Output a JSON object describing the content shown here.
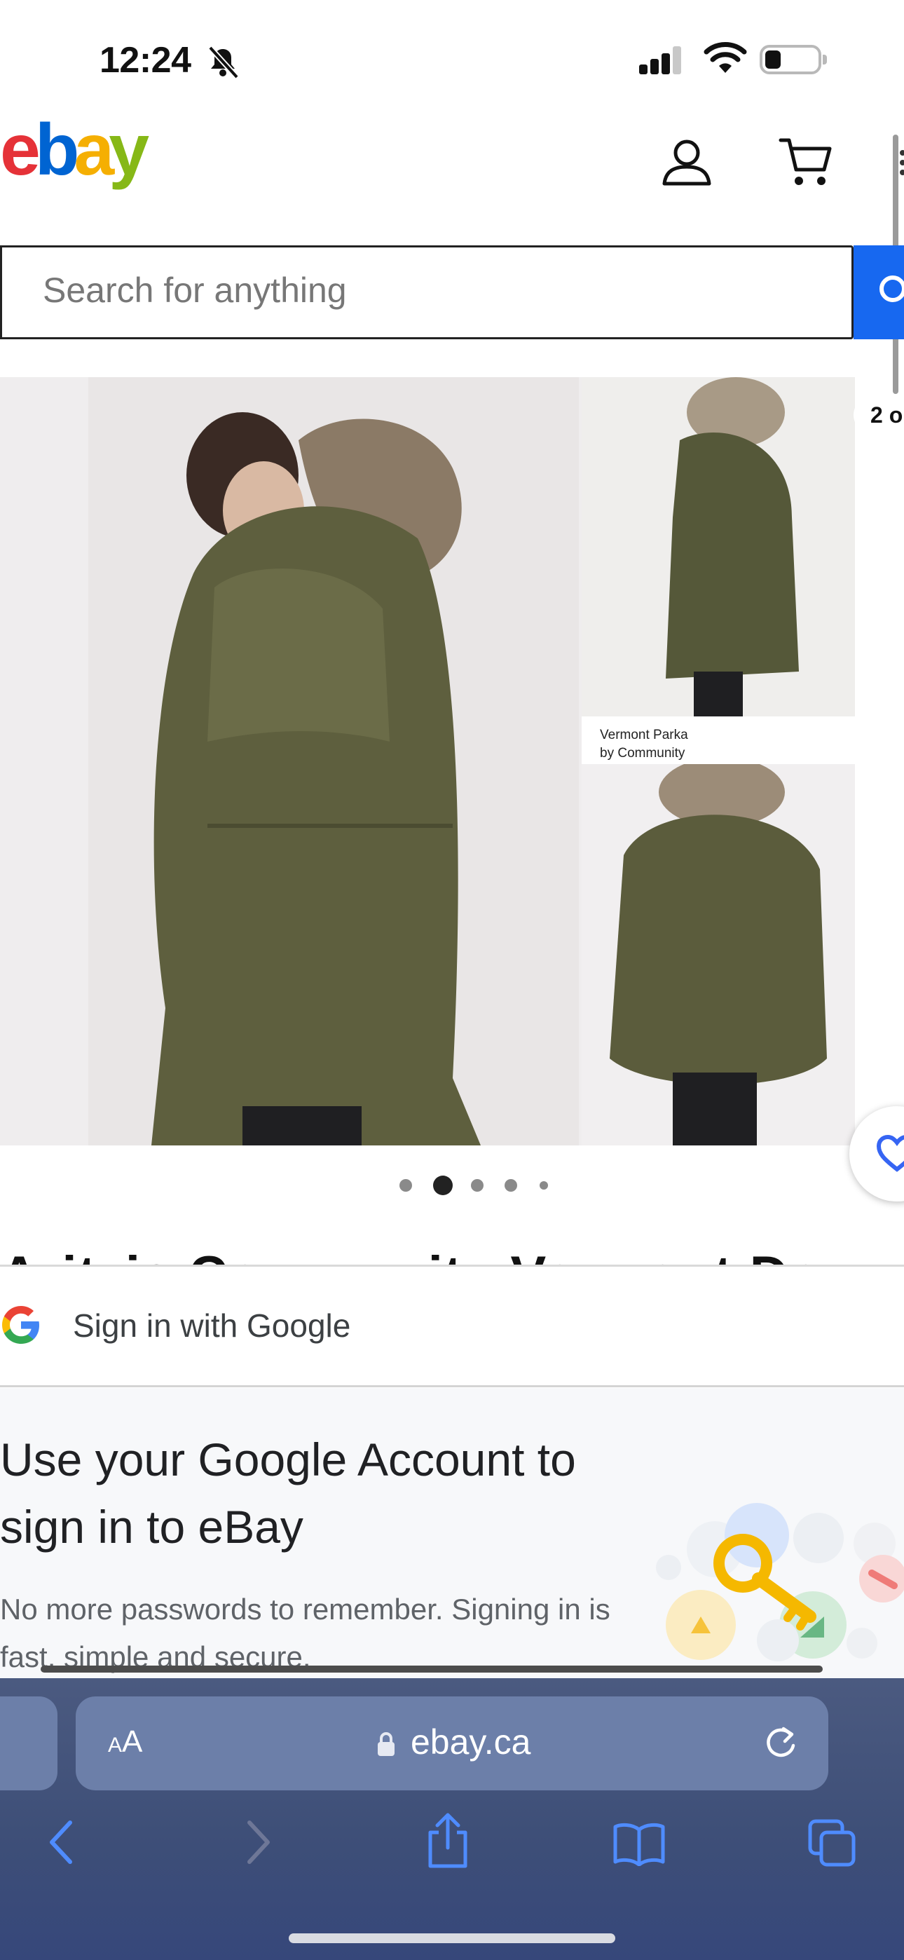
{
  "status_bar": {
    "time": "12:24",
    "icons": [
      "bell-slash-icon",
      "cellular-signal-icon",
      "wifi-icon",
      "battery-icon"
    ]
  },
  "header": {
    "logo_letters": [
      "e",
      "b",
      "a",
      "y"
    ],
    "logo_colors": [
      "#e53238",
      "#0064d2",
      "#f5af02",
      "#86b817"
    ],
    "icons": [
      "user-icon",
      "cart-icon"
    ]
  },
  "search": {
    "placeholder": "Search for anything",
    "button_color": "#1768f0"
  },
  "gallery": {
    "thumb_caption": "Vermont Parka\nby Community",
    "counter": "2 o",
    "dots": {
      "count": 5,
      "active_index": 1
    }
  },
  "listing": {
    "title_peek": "Aritzia Community Vermont Down Parka"
  },
  "google_signin": {
    "title": "Sign in with Google",
    "heading": "Use your Google Account to sign in to eBay",
    "subtext": "No more passwords to remember. Signing in is fast, simple and secure."
  },
  "browser": {
    "text_size_label_small": "A",
    "text_size_label_large": "A",
    "url": "ebay.ca",
    "toolbar_icons": [
      "back-icon",
      "forward-icon",
      "share-icon",
      "bookmarks-icon",
      "tabs-icon"
    ]
  }
}
